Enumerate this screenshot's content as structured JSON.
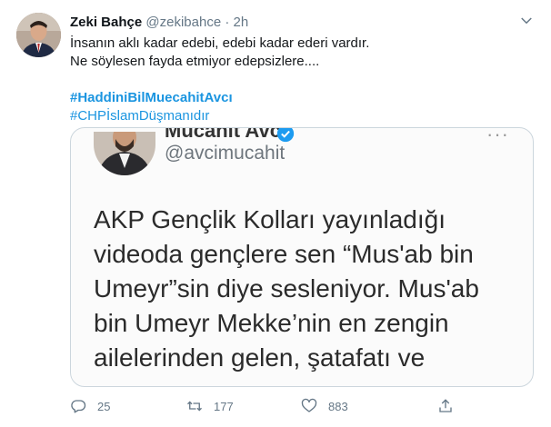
{
  "tweet": {
    "author_name": "Zeki Bahçe",
    "author_handle": "@zekibahce",
    "separator": "·",
    "time": "2h",
    "lines": [
      "İnsanın aklı kadar edebi, edebi kadar ederi vardır.",
      "Ne söylesen fayda etmiyor edepsizlere...."
    ],
    "hashtags": [
      "#HaddiniBilMuecahitAvcı",
      "#CHPİslamDüşmanıdır"
    ]
  },
  "quoted_image": {
    "name": "Mucahit Avcı",
    "handle": "@avcimucahit",
    "more": "···",
    "text_lines": [
      "AKP Gençlik Kolları yayınladığı",
      "videoda gençlere sen “Mus'ab bin",
      "Umeyr”sin diye sesleniyor. Mus'ab",
      "bin Umeyr Mekke’nin en zengin",
      "ailelerinden gelen, şatafatı ve"
    ]
  },
  "actions": {
    "reply_count": "25",
    "retweet_count": "177",
    "like_count": "883"
  },
  "icons": {
    "reply": "reply-icon",
    "retweet": "retweet-icon",
    "like": "heart-icon",
    "share": "share-icon",
    "caret": "chevron-down-icon",
    "verified": "verified-badge-icon"
  },
  "colors": {
    "link": "#1b95e0",
    "secondary": "#657786",
    "text": "#14171a",
    "border": "#ccd6dd"
  }
}
